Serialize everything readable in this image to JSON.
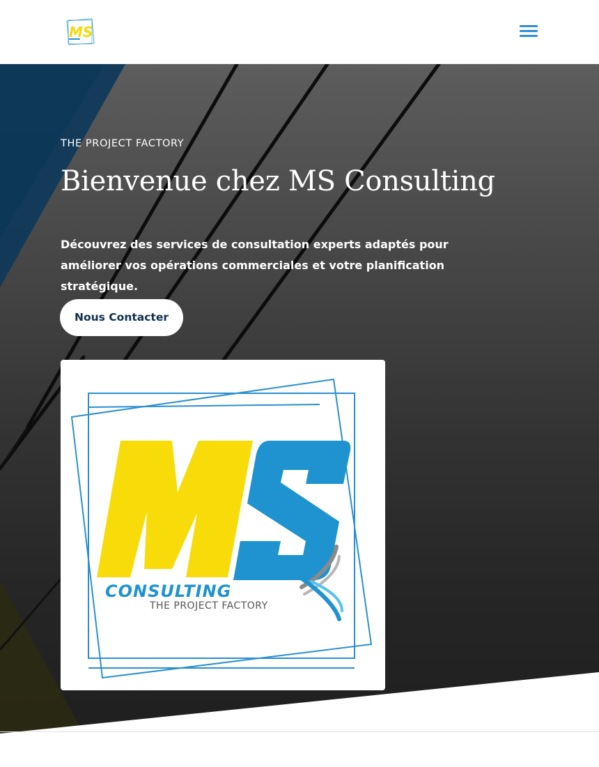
{
  "header": {
    "logo": {
      "text": "MS",
      "icon": "ms-consulting-logo"
    },
    "menu": {
      "icon": "hamburger-menu-icon"
    }
  },
  "hero": {
    "eyebrow": "THE PROJECT FACTORY",
    "title": "Bienvenue chez MS Consulting",
    "description": "Découvrez des services de consultation experts adaptés pour améliorer vos opérations commerciales et votre planification stratégique.",
    "cta_label": "Nous Contacter"
  },
  "logo_card": {
    "monogram_m": "M",
    "monogram_s": "S",
    "wordmark": "CONSULTING",
    "tagline": "THE PROJECT FACTORY"
  },
  "colors": {
    "accent_blue": "#2e8ddb",
    "logo_yellow": "#f5d90a",
    "logo_blue": "#1f93cf",
    "cta_text": "#0f2f4a"
  }
}
